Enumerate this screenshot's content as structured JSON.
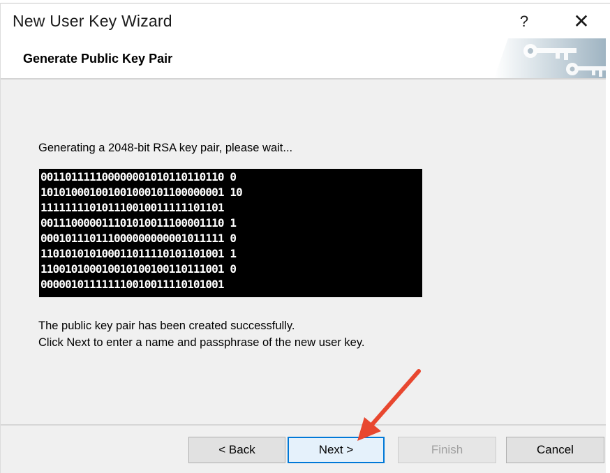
{
  "window": {
    "title": "New User Key Wizard",
    "help_label": "?",
    "close_label": "✕"
  },
  "header": {
    "title": "Generate Public Key Pair",
    "art_icon": "keys-icon"
  },
  "content": {
    "generating_text": "Generating a 2048-bit RSA key pair, please wait...",
    "bit_rows": [
      "001101111100000001010110110110 0",
      "101010001001001000101100000001 10",
      "111111110101110010011111101101",
      "001110000011101010011100001110 1",
      "000101110111000000000001011111 0",
      "110101010100011011110101101001 1",
      "110010100010010100100110111001 0",
      "000001011111110010011110101001"
    ],
    "success_line1": "The public key pair has been created successfully.",
    "success_line2": "Click Next to enter a name and passphrase of the new user key."
  },
  "footer": {
    "back_label": "< Back",
    "next_label": "Next >",
    "finish_label": "Finish",
    "cancel_label": "Cancel"
  },
  "colors": {
    "focus_border": "#0078d7",
    "annotation_arrow": "#e8472f"
  }
}
